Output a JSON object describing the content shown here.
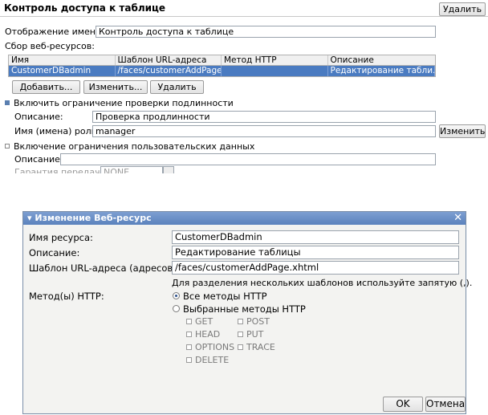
{
  "header": {
    "title": "Контроль доступа к таблице",
    "delete_label": "Удалить"
  },
  "bg": {
    "display_name_label": "Отображение имени:",
    "display_name_value": "Контроль доступа к таблице",
    "collection_label": "Сбор веб-ресурсов:",
    "table": {
      "columns": [
        "Имя",
        "Шаблон URL-адреса",
        "Метод HTTP",
        "Описание"
      ],
      "rows": [
        [
          "CustomerDBadmin",
          "/faces/customerAddPage....",
          "",
          "Редактирование табли..."
        ]
      ]
    },
    "buttons": {
      "add": "Добавить...",
      "edit": "Изменить...",
      "delete": "Удалить"
    },
    "auth": {
      "checkbox_label": "Включить ограничение проверки подлинности",
      "desc_label": "Описание:",
      "desc_value": "Проверка продлинности",
      "roles_label": "Имя (имена) роли:",
      "roles_value": "manager",
      "edit_button": "Изменить"
    },
    "userdata": {
      "checkbox_label": "Включение ограничения пользовательских данных",
      "desc_label": "Описание:",
      "desc_value": "",
      "guarantee_label": "Гарантия передачи:",
      "guarantee_value": "NONE"
    }
  },
  "dialog": {
    "title": "Изменение Веб-ресурс",
    "resource_label": "Имя ресурса:",
    "resource_value": "CustomerDBadmin",
    "desc_label": "Описание:",
    "desc_value": "Редактирование таблицы",
    "url_label": "Шаблон URL-адреса (адресов):",
    "url_value": "/faces/customerAddPage.xhtml",
    "url_hint": "Для разделения нескольких шаблонов используйте запятую (,).",
    "methods_label": "Метод(ы) HTTP:",
    "all_methods": "Все методы HTTP",
    "selected_methods": "Выбранные методы HTTP",
    "methods": {
      "get": "GET",
      "post": "POST",
      "head": "HEAD",
      "put": "PUT",
      "options": "OPTIONS",
      "trace": "TRACE",
      "delete": "DELETE"
    },
    "ok": "OK",
    "cancel": "Отмена"
  }
}
